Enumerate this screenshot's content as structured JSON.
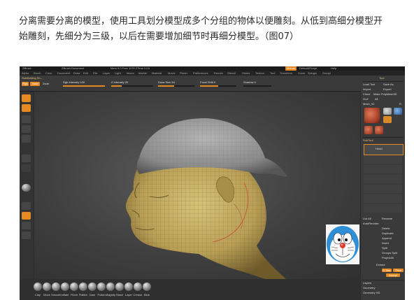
{
  "caption": {
    "line1": "分离需要分离的模型，使用工具划分模型成多个分组的物体以便雕刻。从低到高细分模型开",
    "line2": "始雕刻，先细分为三级，以后在需要增加细节时再细分模型。（图07）"
  },
  "app": {
    "title_left": "ZBrush",
    "title_mid": "ZBrush Document",
    "title_stats": "Mem 9.0 Free 1178 ZTime 0.04",
    "menus_btn": "Menus",
    "script_btn": "DefaultZScript",
    "help_btn": "Help",
    "menu_items": [
      "Alpha",
      "Brush",
      "Color",
      "Document",
      "Draw",
      "Edit",
      "File",
      "Layer",
      "Light",
      "Macro",
      "Marker",
      "Material",
      "Movie",
      "Picker",
      "Preferences",
      "Render",
      "Stencil",
      "Stroke",
      "Texture",
      "Tool",
      "Transform",
      "Zoom",
      "Zplugin",
      "Zscript"
    ]
  },
  "topbar": {
    "subtool_title": "Subdividing Sh...",
    "rgb_label": "Rgb",
    "zadd_label": "Zadd",
    "zsub_label": "Zsub",
    "rgb_intensity_label": "Rgb Intensity 100",
    "rgb_intensity_value": 1.0,
    "z_intensity_label": "Z Intensity 25",
    "z_intensity_value": 0.25,
    "draw_size_label": "Draw Size 64",
    "draw_size_value": 0.45,
    "focal_shift_label": "Focal Shift 0",
    "focal_shift_value": 0.5,
    "shadow_label": "Shadow 0"
  },
  "rightpanel": {
    "header": "Tool",
    "load_tool": "Load Tool",
    "save_as": "Save As",
    "import": "Import",
    "export": "Export",
    "clone": "Clone",
    "make_polymesh": "Make PolyMesh3D",
    "goz": "GoZ",
    "all": "All",
    "mesh_label": "Mesh_92",
    "r": "R",
    "simple_brush": "SimpleBrush",
    "sphere_label": "Sphere3D",
    "polymesh_label": "PolyMesh3D",
    "subtool": "SubTool",
    "list_all": "List All",
    "rename": "Rename",
    "autoreorder": "AutoReorder",
    "delete": "Delete",
    "duplicate": "Duplicate",
    "append": "Append",
    "insert": "Insert",
    "split": "Split",
    "groups_split": "Groups Split",
    "project_all": "ProjectAll",
    "extract": "Extract",
    "smt": "S Smt",
    "thick": "Thick",
    "accept": "Accept",
    "layers": "Layers",
    "geometry": "Geometry",
    "geometry_hd": "Geometry HD",
    "head_label": "Head"
  },
  "bottombar": {
    "brushes": [
      "Clay",
      "Move",
      "Smooth",
      "Inflate",
      "Pinch",
      "Flatten",
      "Dam",
      "Polish",
      "Magnify",
      "Slash",
      "Layer",
      "Crease",
      "Blob"
    ]
  },
  "colors": {
    "accent": "#e58a22",
    "panel": "#3a3a3a",
    "canvas": "#474747",
    "skin": "#c9b06a",
    "cap": "#8f8f8f"
  }
}
